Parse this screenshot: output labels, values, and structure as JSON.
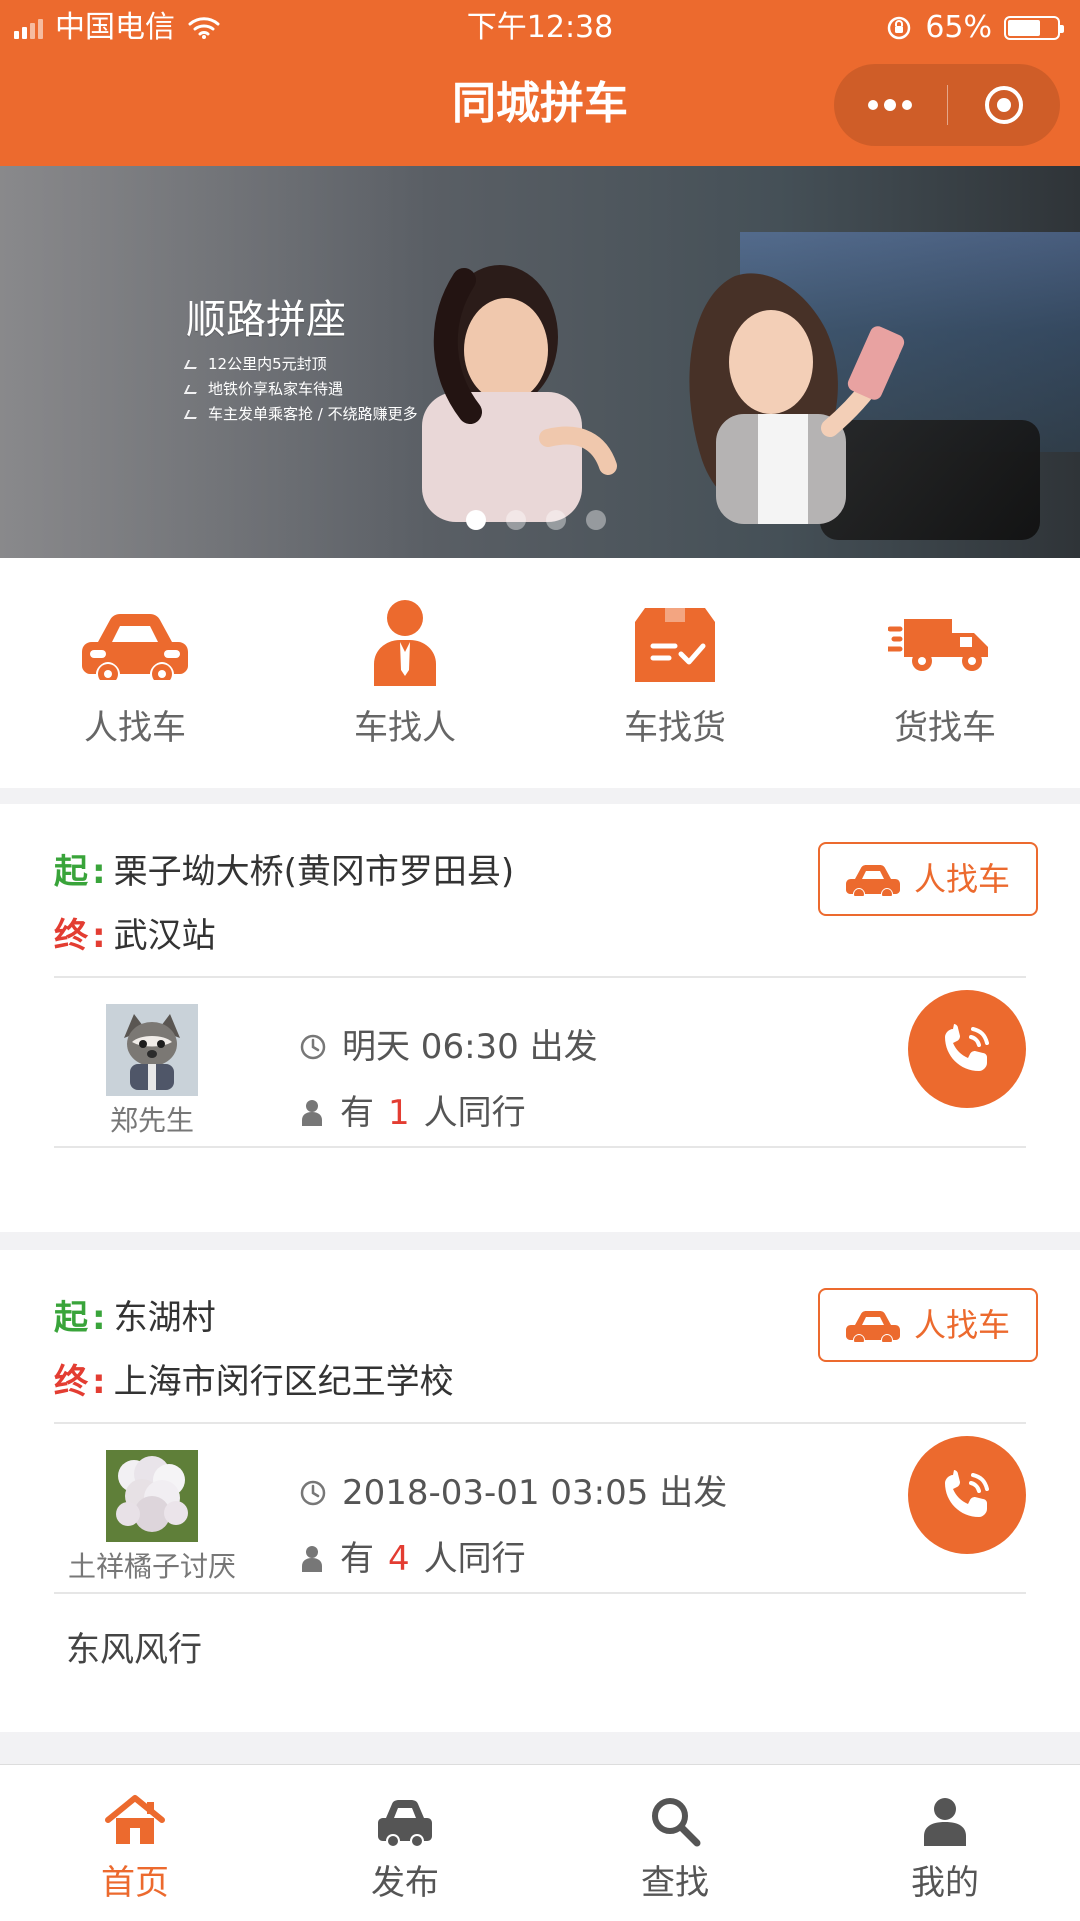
{
  "status_bar": {
    "carrier": "中国电信",
    "time": "下午12:38",
    "battery": "65%"
  },
  "header": {
    "title": "同城拼车"
  },
  "banner": {
    "title": "顺路拼座",
    "bullets": [
      "12公里内5元封顶",
      "地铁价享私家车待遇",
      "车主发单乘客抢 / 不绕路赚更多"
    ]
  },
  "quick_nav": [
    {
      "label": "人找车",
      "icon": "car-icon"
    },
    {
      "label": "车找人",
      "icon": "person-icon"
    },
    {
      "label": "车找货",
      "icon": "cargo-box-icon"
    },
    {
      "label": "货找车",
      "icon": "truck-icon"
    }
  ],
  "route_labels": {
    "start": "起",
    "end": "终",
    "separator": ":"
  },
  "cards": [
    {
      "start": "栗子坳大桥(黄冈市罗田县)",
      "end": "武汉站",
      "role": "人找车",
      "user": "郑先生",
      "departure": "明天 06:30 出发",
      "companions_prefix": "有",
      "companions_count": "1",
      "companions_suffix": "人同行",
      "note": ""
    },
    {
      "start": "东湖村",
      "end": "上海市闵行区纪王学校",
      "role": "人找车",
      "user": "土祥橘子讨厌",
      "departure": "2018-03-01 03:05 出发",
      "companions_prefix": "有",
      "companions_count": "4",
      "companions_suffix": "人同行",
      "note": "东风风行"
    }
  ],
  "tabbar": [
    {
      "label": "首页",
      "icon": "home-icon",
      "active": true
    },
    {
      "label": "发布",
      "icon": "car-icon",
      "active": false
    },
    {
      "label": "查找",
      "icon": "search-icon",
      "active": false
    },
    {
      "label": "我的",
      "icon": "user-icon",
      "active": false
    }
  ],
  "colors": {
    "brand": "#ec6a2e",
    "start": "#39a43a",
    "end": "#e33d32",
    "text": "#333333"
  }
}
